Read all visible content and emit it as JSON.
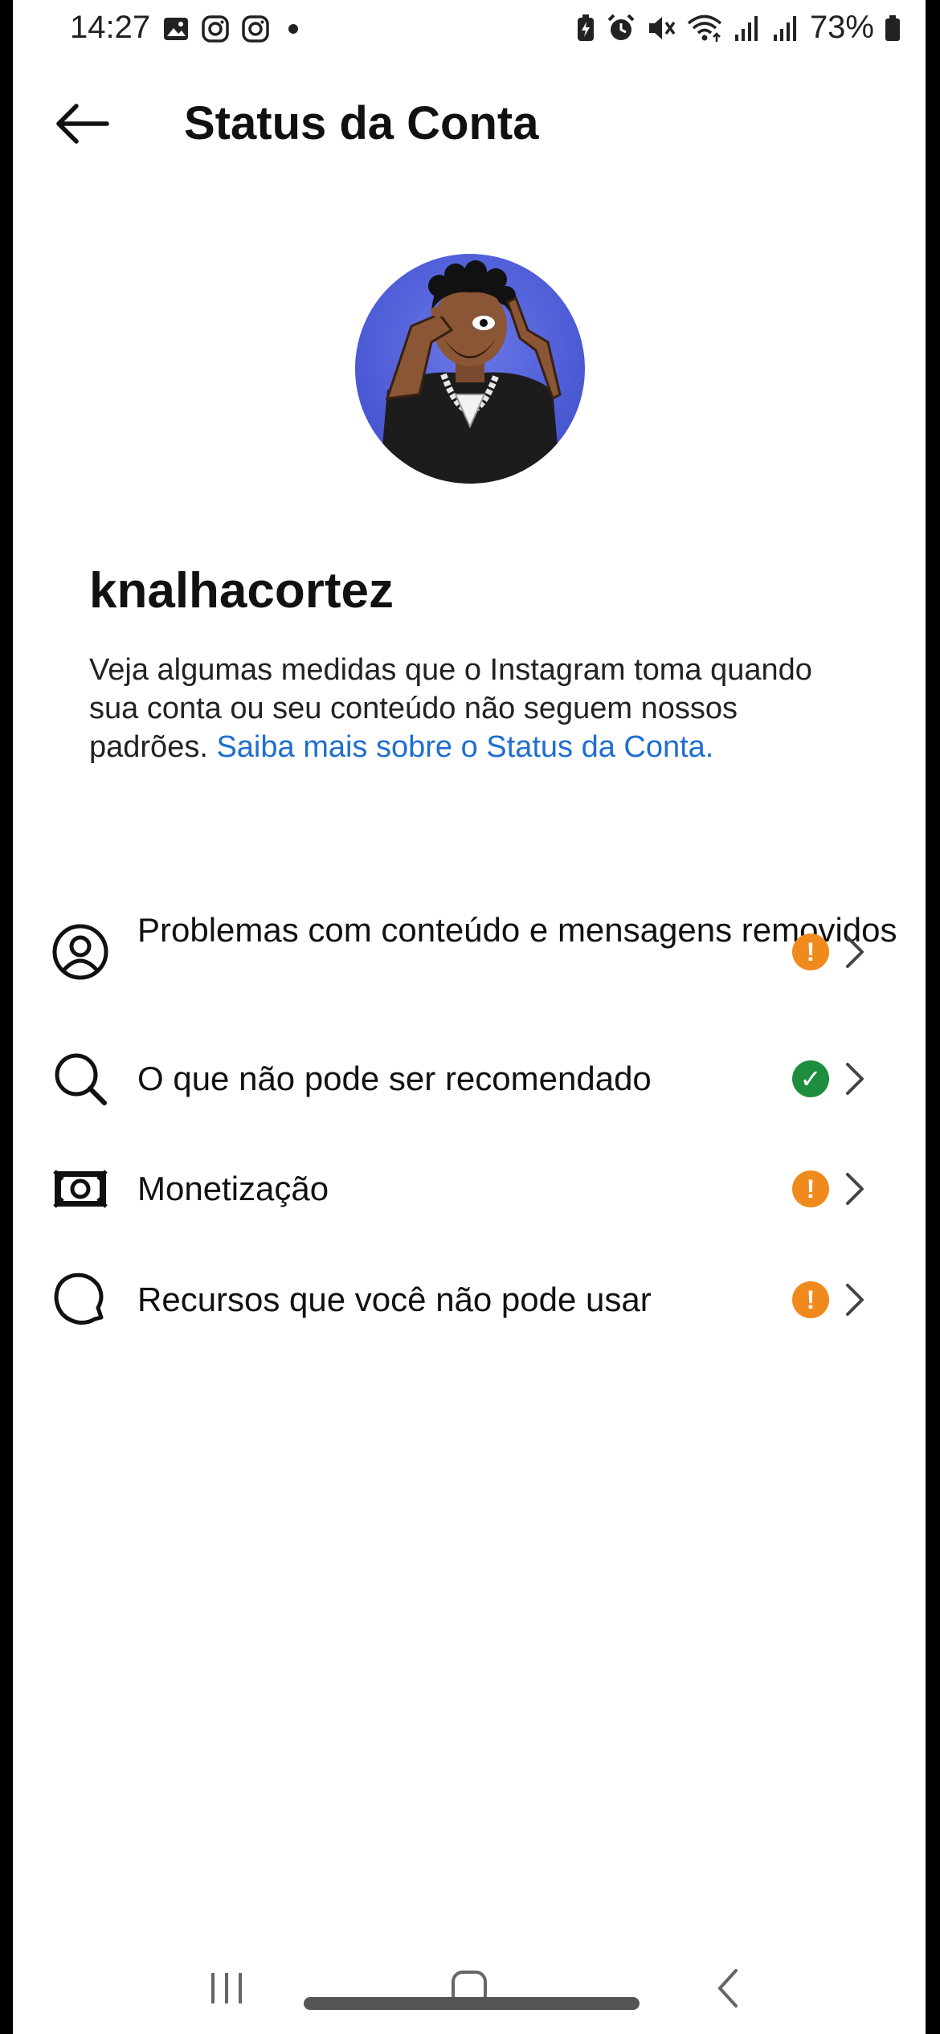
{
  "status_bar": {
    "time": "14:27",
    "battery_pct": "73%",
    "left_icons": [
      "gallery-icon",
      "instagram-icon",
      "instagram-icon",
      "dot-icon"
    ],
    "right_icons": [
      "battery-saver-icon",
      "alarm-icon",
      "mute-icon",
      "wifi-icon",
      "signal-icon",
      "signal-icon",
      "battery-icon"
    ]
  },
  "header": {
    "title": "Status da Conta",
    "back_icon": "arrow-left-icon"
  },
  "profile": {
    "username": "knalhacortez",
    "description": "Veja algumas medidas que o Instagram toma quando sua conta ou seu conteúdo não seguem nossos padrões. ",
    "link_text": "Saiba mais sobre o Status da Conta."
  },
  "items": [
    {
      "label": "Problemas com conteúdo e mensagens removidos",
      "icon": "user-circle-icon",
      "status": "warning"
    },
    {
      "label": "O que não pode ser recomendado",
      "icon": "search-icon",
      "status": "ok"
    },
    {
      "label": "Monetização",
      "icon": "money-icon",
      "status": "warning"
    },
    {
      "label": "Recursos que você não pode usar",
      "icon": "speech-bubble-icon",
      "status": "warning"
    }
  ],
  "colors": {
    "warning": "#f08a1c",
    "ok": "#1e8e3e",
    "link": "#1f6ed1"
  },
  "status_glyphs": {
    "warning": "!",
    "ok": "✓"
  }
}
